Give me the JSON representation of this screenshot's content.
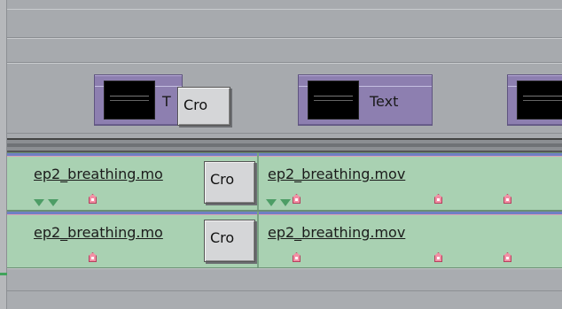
{
  "video_track": {
    "clips": [
      {
        "label": "T",
        "thumb_text": ""
      },
      {
        "label": "Text",
        "thumb_text": ""
      },
      {
        "label": "",
        "thumb_text": ""
      }
    ],
    "transition_label": "Cro"
  },
  "audio_tracks": [
    {
      "clips": [
        {
          "name": "ep2_breathing.mo"
        },
        {
          "name": "ep2_breathing.mov"
        }
      ],
      "transition_label": "Cro"
    },
    {
      "clips": [
        {
          "name": "ep2_breathing.mo"
        },
        {
          "name": "ep2_breathing.mov"
        }
      ],
      "transition_label": "Cro"
    }
  ],
  "colors": {
    "title_clip": "#8d7fb0",
    "audio_clip": "#a9d1b2",
    "marker": "#f28fa4",
    "audio_rail": "#6f7fc4"
  }
}
